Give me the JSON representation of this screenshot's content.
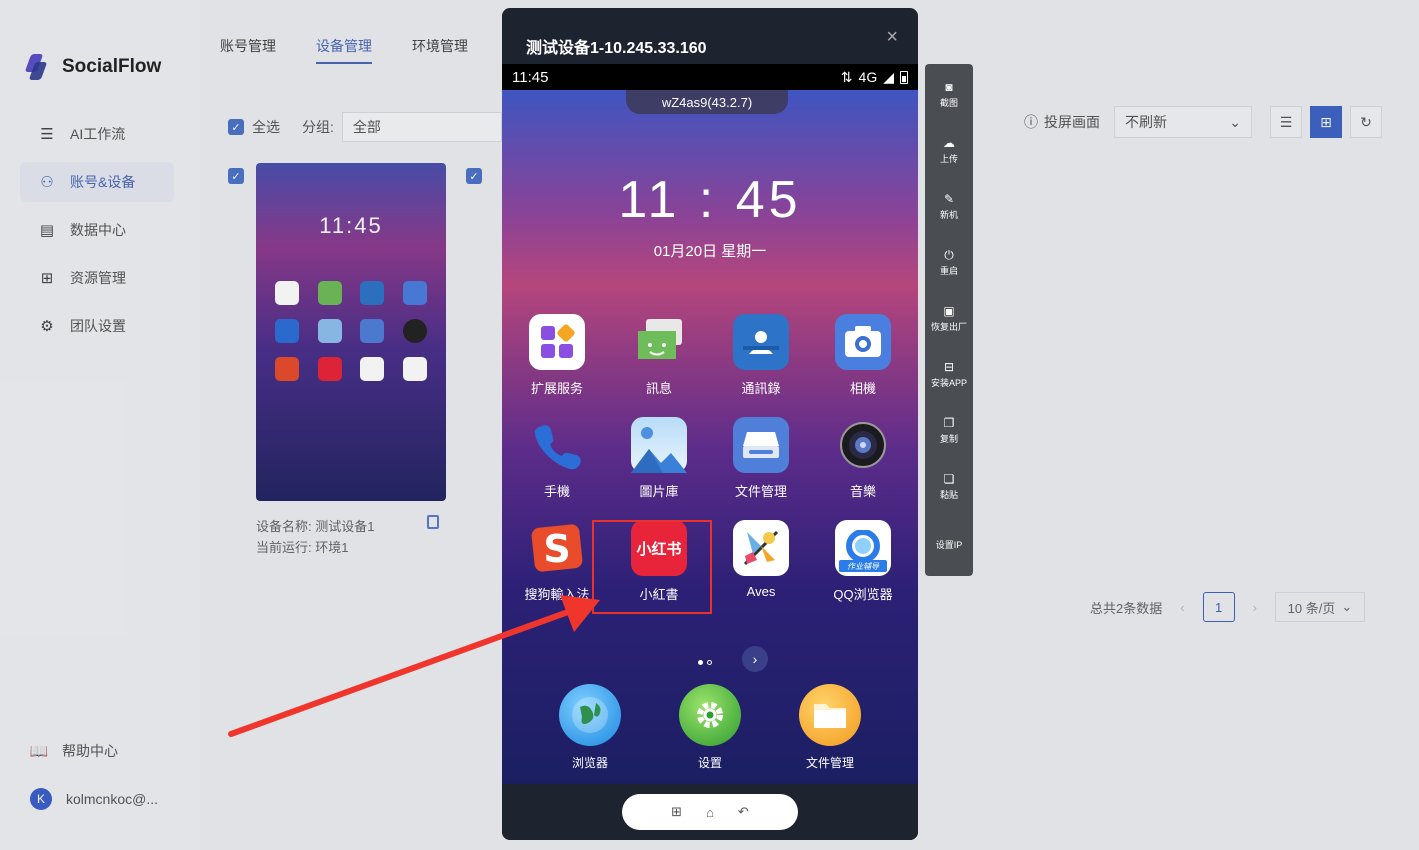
{
  "app": {
    "brand": "SocialFlow"
  },
  "sidebar": {
    "items": [
      {
        "label": "AI工作流",
        "icon": "workflow-icon"
      },
      {
        "label": "账号&设备",
        "icon": "users-icon"
      },
      {
        "label": "数据中心",
        "icon": "database-icon"
      },
      {
        "label": "资源管理",
        "icon": "grid-icon"
      },
      {
        "label": "团队设置",
        "icon": "gear-icon"
      }
    ],
    "help": "帮助中心",
    "user": {
      "initial": "K",
      "name": "kolmcnkoc@..."
    }
  },
  "tabs": [
    "账号管理",
    "设备管理",
    "环境管理"
  ],
  "toolbar": {
    "select_all": "全选",
    "group_label": "分组:",
    "group_value": "全部",
    "projection": "投屏画面",
    "refresh_value": "不刷新"
  },
  "device_card": {
    "name_line": "设备名称: 测试设备1",
    "env_line": "当前运行: 环境1",
    "time": "11:45"
  },
  "pagination": {
    "total": "总共2条数据",
    "page": "1",
    "page_size": "10 条/页"
  },
  "modal": {
    "title": "测试设备1-10.245.33.160",
    "close": "×",
    "statusbar": {
      "time": "11:45",
      "network": "4G"
    },
    "device_id": "wZ4as9(43.2.7)",
    "clock": "11 : 45",
    "date": "01月20日  星期一",
    "apps": [
      {
        "label": "扩展服务",
        "icon": "extension-icon"
      },
      {
        "label": "訊息",
        "icon": "message-icon"
      },
      {
        "label": "通訊錄",
        "icon": "contacts-icon"
      },
      {
        "label": "相機",
        "icon": "camera-icon"
      },
      {
        "label": "手機",
        "icon": "phone-icon"
      },
      {
        "label": "圖片庫",
        "icon": "gallery-icon"
      },
      {
        "label": "文件管理",
        "icon": "file-manager-icon"
      },
      {
        "label": "音樂",
        "icon": "music-icon"
      },
      {
        "label": "搜狗輸入法",
        "icon": "sogou-icon"
      },
      {
        "label": "小紅書",
        "icon": "xiaohongshu-icon",
        "icon_text": "小红书"
      },
      {
        "label": "Aves",
        "icon": "aves-icon"
      },
      {
        "label": "QQ浏览器",
        "icon": "qq-browser-icon",
        "icon_text": "作业辅导"
      }
    ],
    "dock": [
      {
        "label": "浏览器",
        "icon": "browser-icon"
      },
      {
        "label": "设置",
        "icon": "settings-icon"
      },
      {
        "label": "文件管理",
        "icon": "folder-icon"
      }
    ]
  },
  "side_tools": [
    "截图",
    "上传",
    "新机",
    "重启",
    "恢复出厂",
    "安装APP",
    "复制",
    "黏贴",
    "设置IP"
  ],
  "colors": {
    "accent": "#3d63c4",
    "highlight": "#e8322a",
    "arrow": "#f0362c"
  }
}
